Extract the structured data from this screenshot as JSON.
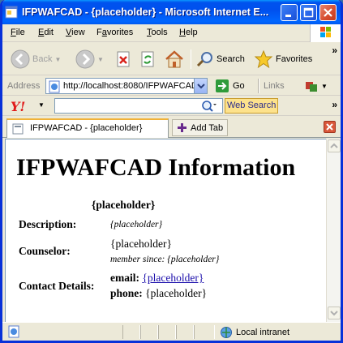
{
  "window": {
    "title": "IFPWAFCAD - {placeholder} - Microsoft Internet E..."
  },
  "menu": {
    "items": [
      "File",
      "Edit",
      "View",
      "Favorites",
      "Tools",
      "Help"
    ],
    "accel": [
      "F",
      "E",
      "V",
      "a",
      "T",
      "H"
    ]
  },
  "toolbar": {
    "back_label": "Back",
    "search_label": "Search",
    "favorites_label": "Favorites"
  },
  "address": {
    "label": "Address",
    "url": "http://localhost:8080/IFPWAFCAD",
    "go_label": "Go",
    "links_label": "Links"
  },
  "yahoo": {
    "logo": "Y!",
    "search_value": "",
    "search_button": "Web Search"
  },
  "tabs": {
    "active_label": "IFPWAFCAD - {placeholder}",
    "add_tab_label": "Add Tab"
  },
  "page": {
    "heading": "IFPWAFCAD Information",
    "caption": "{placeholder}",
    "description_label": "Description:",
    "description_value": "{placeholder}",
    "counselor_label": "Counselor:",
    "counselor_name": "{placeholder}",
    "counselor_since": "member since: {placeholder}",
    "contact_label": "Contact Details:",
    "email_label": "email:",
    "email_value": "{placeholder}",
    "phone_label": "phone:",
    "phone_value": "{placeholder}"
  },
  "status": {
    "zone": "Local intranet"
  },
  "colors": {
    "titlebar": "#0053ee",
    "chrome": "#ece9d8",
    "link": "#1a0dab",
    "yahoo_red": "#e01b1b"
  }
}
